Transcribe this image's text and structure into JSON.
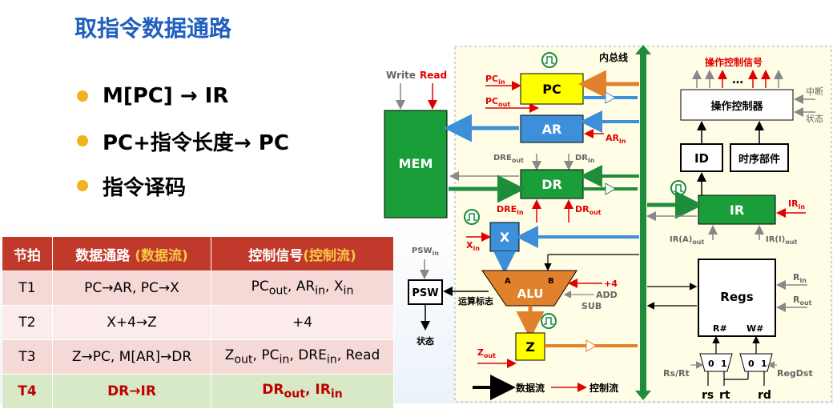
{
  "title": "取指令数据通路",
  "bullets": [
    "M[PC] → IR",
    "PC+指令长度→ PC",
    "指令译码"
  ],
  "table": {
    "headers": {
      "col0": "节拍",
      "col1_main": "数据通路",
      "col1_hl": "(数据流)",
      "col2_main": "控制信号",
      "col2_hl": "(控制流)"
    },
    "rows": [
      {
        "step": "T1",
        "datapath": "PC→AR,  PC→X",
        "signals": "PCout, ARin, Xin"
      },
      {
        "step": "T2",
        "datapath": "X+4→Z",
        "signals": "+4"
      },
      {
        "step": "T3",
        "datapath": "Z→PC,  M[AR]→DR",
        "signals": "Zout, PCin, DREin, Read"
      },
      {
        "step": "T4",
        "datapath": "DR→IR",
        "signals": "DRout, IRin"
      }
    ]
  },
  "diagram": {
    "internal_bus": "内总线",
    "ctrl_signals": "操作控制信号",
    "ellipsis": "…",
    "ctrl_unit": "操作控制器",
    "interrupt": "中断",
    "status_in": "状态",
    "id": "ID",
    "timing": "时序部件",
    "ir": "IR",
    "ir_a_out": "IR(A)",
    "ir_i_out": "IR(I)",
    "out_sub": "out",
    "in_sub": "in",
    "write": "Write",
    "read": "Read",
    "mem": "MEM",
    "pc": "PC",
    "ar": "AR",
    "dr": "DR",
    "x": "X",
    "z": "Z",
    "psw": "PSW",
    "alu": "ALU",
    "alu_a": "A",
    "alu_b": "B",
    "plus4": "+4",
    "add": "ADD",
    "sub": "SUB",
    "flags": "运算标志",
    "status_out": "状态",
    "regs": "Regs",
    "r_in": "R",
    "r_out": "R",
    "r_hash": "R#",
    "w_hash": "W#",
    "rs_rt": "Rs/Rt",
    "regdst": "RegDst",
    "mux0": "0",
    "mux1": "1",
    "rs": "rs",
    "rt": "rt",
    "rd": "rd",
    "legend_data": "数据流",
    "legend_ctrl": "控制流",
    "dre": "DRE",
    "colors": {
      "bus": "#1e8c3a",
      "mem": "#1a9e3a",
      "yellow": "#ffff00",
      "blue": "#3d8fd9",
      "red": "#e00000",
      "orange": "#e2812b",
      "panel": "#fffde6"
    }
  }
}
